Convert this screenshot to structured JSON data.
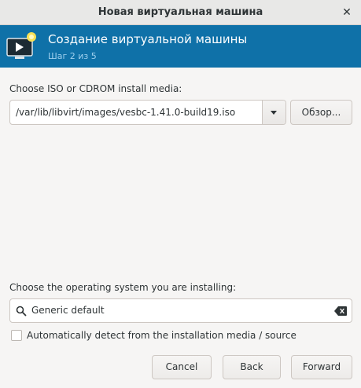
{
  "window": {
    "title": "Новая виртуальная машина",
    "close_icon": "close-icon"
  },
  "banner": {
    "title": "Создание виртуальной машины",
    "step": "Шаг 2 из 5",
    "icon": "monitor-new-icon",
    "background": "#0f71a8"
  },
  "install_media": {
    "label": "Choose ISO or CDROM install media:",
    "path": "/var/lib/libvirt/images/vesbc-1.41.0-build19.iso",
    "browse_label": "Обзор..."
  },
  "os_select": {
    "label": "Choose the operating system you are installing:",
    "search_value": "Generic default",
    "auto_detect_label": "Automatically detect from the installation media / source",
    "auto_detect_checked": false
  },
  "buttons": {
    "cancel": "Cancel",
    "back": "Back",
    "forward": "Forward"
  }
}
